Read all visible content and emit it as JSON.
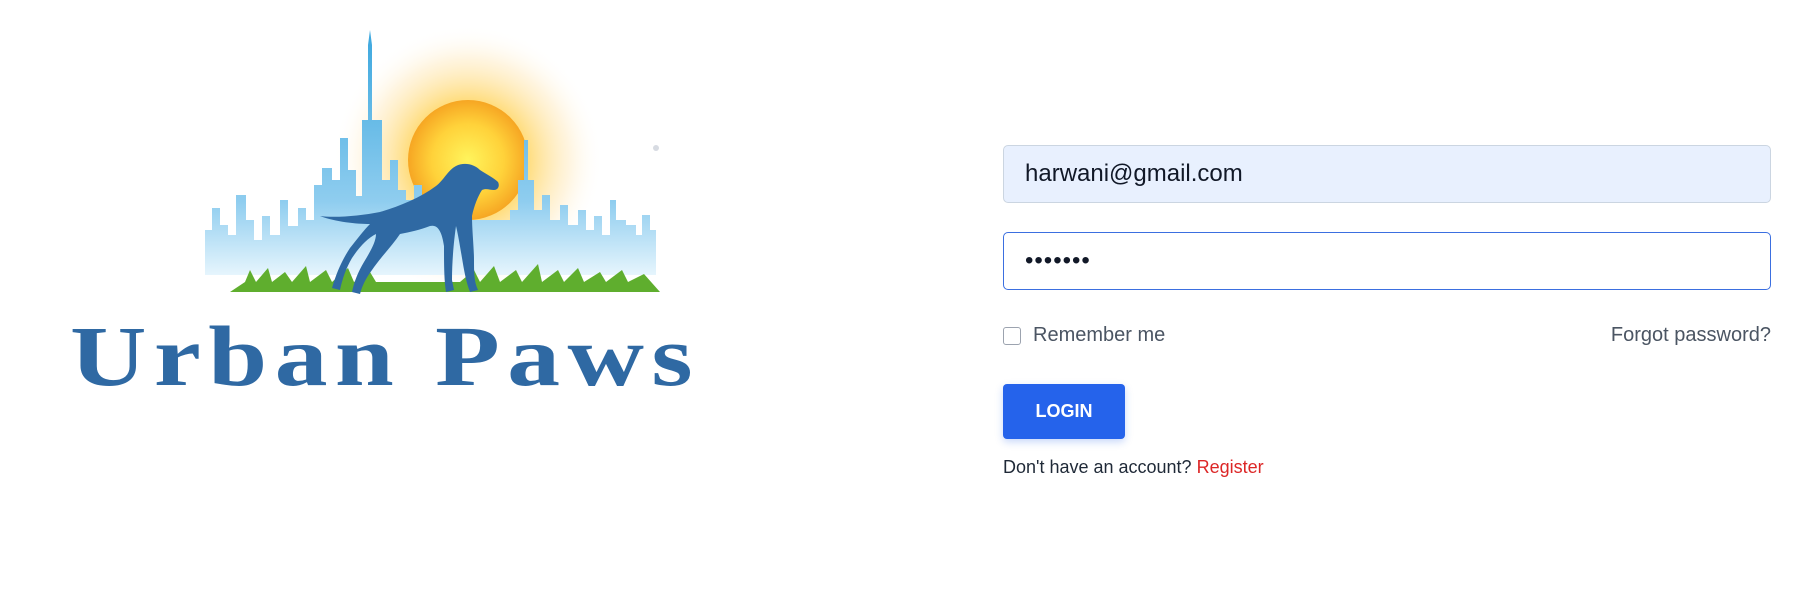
{
  "logo": {
    "text": "Urban Paws",
    "colors": {
      "brand_blue": "#2f69a3",
      "sky_blue": "#4fb3e6",
      "sun_yellow": "#ffd93b",
      "sun_orange": "#f7a823",
      "grass_green": "#5fae2e",
      "dog_blue": "#2f69a3"
    }
  },
  "form": {
    "email_value": "harwani@gmail.com",
    "password_value": "•••••••",
    "remember_label": "Remember me",
    "remember_checked": false,
    "forgot_label": "Forgot password?",
    "login_label": "LOGIN",
    "register_prompt": "Don't have an account? ",
    "register_label": "Register"
  },
  "colors": {
    "primary": "#2563eb",
    "link_red": "#dc2626",
    "autofill_bg": "#e8f0fe"
  }
}
